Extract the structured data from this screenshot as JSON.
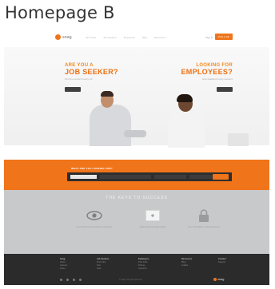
{
  "heading": "Homepage B",
  "colors": {
    "accent": "#f0741a",
    "dark": "#2b2b2b",
    "grey_band": "#c8c9cb"
  },
  "nav": {
    "logo_text": "snag",
    "links": [
      "Find Jobs",
      "Job Seekers",
      "Employers",
      "Blog",
      "Resources"
    ],
    "signin": "Sign In",
    "cta": "Post a Job"
  },
  "hero": {
    "left": {
      "small": "ARE YOU A",
      "big": "JOB SEEKER?",
      "sub": "Find the perfect hourly job",
      "button": "Search"
    },
    "right": {
      "small": "LOOKING FOR",
      "big": "EMPLOYEES?",
      "sub": "Hire qualified hourly workers",
      "button": "Post"
    }
  },
  "search": {
    "title": "WHAT ARE YOU LOOKING FOR?",
    "fields": [
      "Category",
      "Keyword",
      "Location",
      "Distance"
    ],
    "button": "Search"
  },
  "keys": {
    "title": "THE KEYS TO SUCCESS",
    "features": [
      {
        "icon": "eye-icon",
        "caption": "Get noticed by thousands of employers"
      },
      {
        "icon": "screen-icon",
        "caption": "Apply with one simple profile"
      },
      {
        "icon": "lock-icon",
        "caption": "Your information is safe and secure"
      }
    ]
  },
  "footer": {
    "columns": [
      {
        "title": "Snag",
        "items": [
          "About",
          "Careers",
          "Press"
        ]
      },
      {
        "title": "Job Seekers",
        "items": [
          "Find Jobs",
          "Tips",
          "Help"
        ]
      },
      {
        "title": "Employers",
        "items": [
          "Post Jobs",
          "Pricing",
          "Solutions"
        ]
      },
      {
        "title": "Resources",
        "items": [
          "Blog",
          "Guides"
        ]
      },
      {
        "title": "Contact",
        "items": [
          "Support"
        ]
      }
    ],
    "copyright": "© Snag. All rights reserved.",
    "logo_text": "snag"
  }
}
